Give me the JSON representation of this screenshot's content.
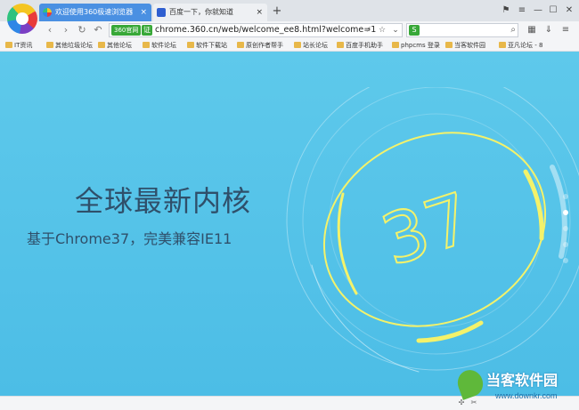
{
  "tabs": [
    {
      "label": "欢迎使用360极速浏览器",
      "active": true,
      "close": "×"
    },
    {
      "label": "百度一下，你就知道",
      "active": false,
      "close": "×"
    }
  ],
  "tabbar": {
    "new_tab": "+",
    "controls": [
      "⚑",
      "≡",
      "—",
      "☐",
      "✕"
    ]
  },
  "nav": {
    "back": "‹",
    "forward": "›",
    "refresh": "↻",
    "undo": "↶",
    "badge": "360官网",
    "cert": "证",
    "url": "chrome.360.cn/web/welcome_ee8.html?welcome=1",
    "bolt": "⚡",
    "star": "☆",
    "dropdown": "⌄",
    "search_icon": "S",
    "search_placeholder": "",
    "search_btn": "⌕",
    "tools": [
      "▦",
      "⇓",
      "≡"
    ]
  },
  "bookmarks": [
    "IT资讯",
    "其他垃圾论坛",
    "其他论坛",
    "软件论坛",
    "软件下载站",
    "原创作者帮手",
    "站长论坛",
    "百度手机助手",
    "phpcms 登录",
    "当客软件园",
    "亚凡论坛 - 8"
  ],
  "content": {
    "headline": "全球最新内核",
    "subline": "基于Chrome37，完美兼容IE11",
    "dial_number": "37",
    "page_count": 5,
    "active_page": 2
  },
  "watermark": {
    "title": "当客软件园",
    "url": "www.downkr.com"
  },
  "colors": {
    "accent": "#4a90e2",
    "page_bg": "#5ec9eb",
    "dial_yellow": "#f4f26a"
  }
}
